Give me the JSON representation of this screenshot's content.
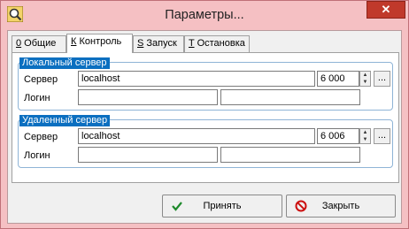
{
  "window": {
    "title": "Параметры...",
    "close_symbol": "✕",
    "app_icon": "magnifier-icon"
  },
  "tabs": [
    {
      "hotkey": "0",
      "label": " Общие",
      "active": false
    },
    {
      "hotkey": "К",
      "label": " Контроль",
      "active": true
    },
    {
      "hotkey": "S",
      "label": " Запуск",
      "active": false
    },
    {
      "hotkey": "T",
      "label": " Остановка",
      "active": false
    }
  ],
  "local_server": {
    "title": "Локальный сервер",
    "server_label": "Сервер",
    "server_value": "localhost",
    "port_value": "6 000",
    "login_label": "Логин",
    "login_value": "",
    "password_value": "",
    "browse_label": "..."
  },
  "remote_server": {
    "title": "Удаленный сервер",
    "server_label": "Сервер",
    "server_value": "localhost",
    "port_value": "6 006",
    "login_label": "Логин",
    "login_value": "",
    "password_value": "",
    "browse_label": "..."
  },
  "buttons": {
    "accept": "Принять",
    "close": "Закрыть"
  },
  "colors": {
    "window_frame": "#f5c0c3",
    "group_title_bg": "#0b6fc0",
    "close_button": "#c0392b",
    "accept_icon": "#1e8a2c",
    "close_icon": "#cc1010"
  }
}
